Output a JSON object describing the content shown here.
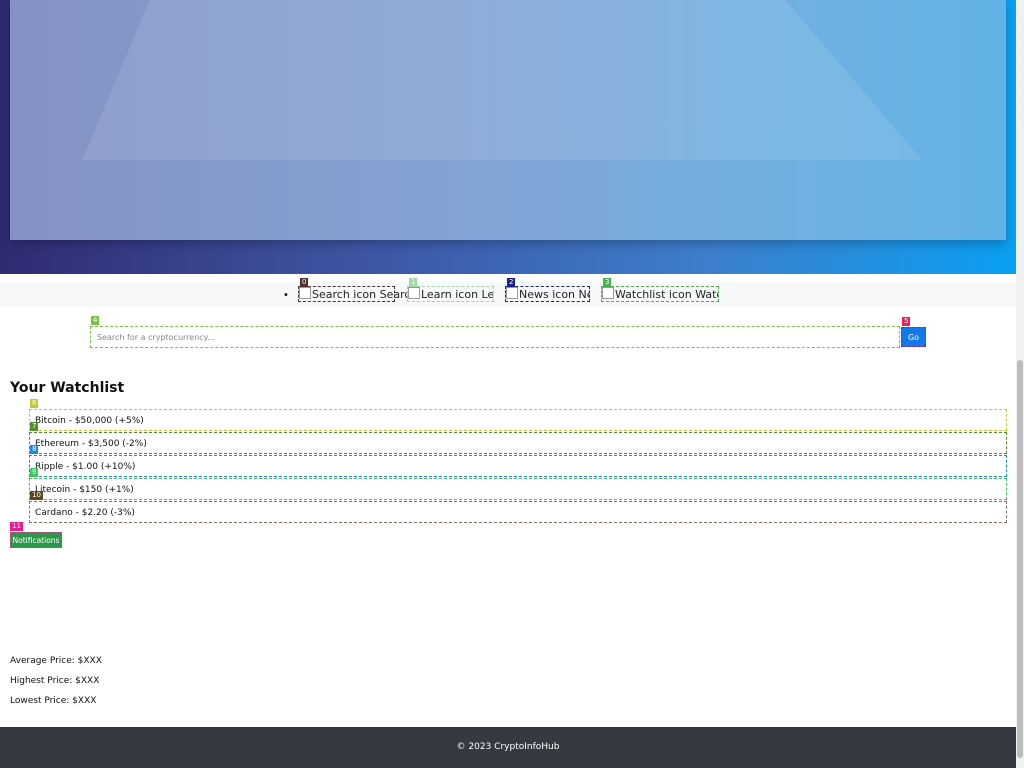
{
  "nav": {
    "bullet": "•",
    "links": [
      {
        "tag": "0",
        "label": "Search icon Search"
      },
      {
        "tag": "1",
        "label": "Learn icon Learn"
      },
      {
        "tag": "2",
        "label": "News icon News"
      },
      {
        "tag": "3",
        "label": "Watchlist icon Watchlist"
      }
    ]
  },
  "search": {
    "tag": "4",
    "placeholder": "Search for a cryptocurrency...",
    "button_tag": "5",
    "button_label": "Go"
  },
  "watchlist": {
    "title": "Your Watchlist",
    "items": [
      {
        "tag": "6",
        "text": "Bitcoin - $50,000 (+5%)"
      },
      {
        "tag": "7",
        "text": "Ethereum - $3,500 (-2%)"
      },
      {
        "tag": "8",
        "text": "Ripple - $1.00 (+10%)"
      },
      {
        "tag": "9",
        "text": "Litecoin - $150 (+1%)"
      },
      {
        "tag": "10",
        "text": "Cardano - $2.20 (-3%)"
      }
    ]
  },
  "notifications": {
    "tag": "11",
    "label": "Notifications"
  },
  "stats": {
    "average": "Average Price: $XXX",
    "highest": "Highest Price: $XXX",
    "lowest": "Lowest Price: $XXX"
  },
  "footer": {
    "text": "© 2023 CryptoInfoHub"
  }
}
